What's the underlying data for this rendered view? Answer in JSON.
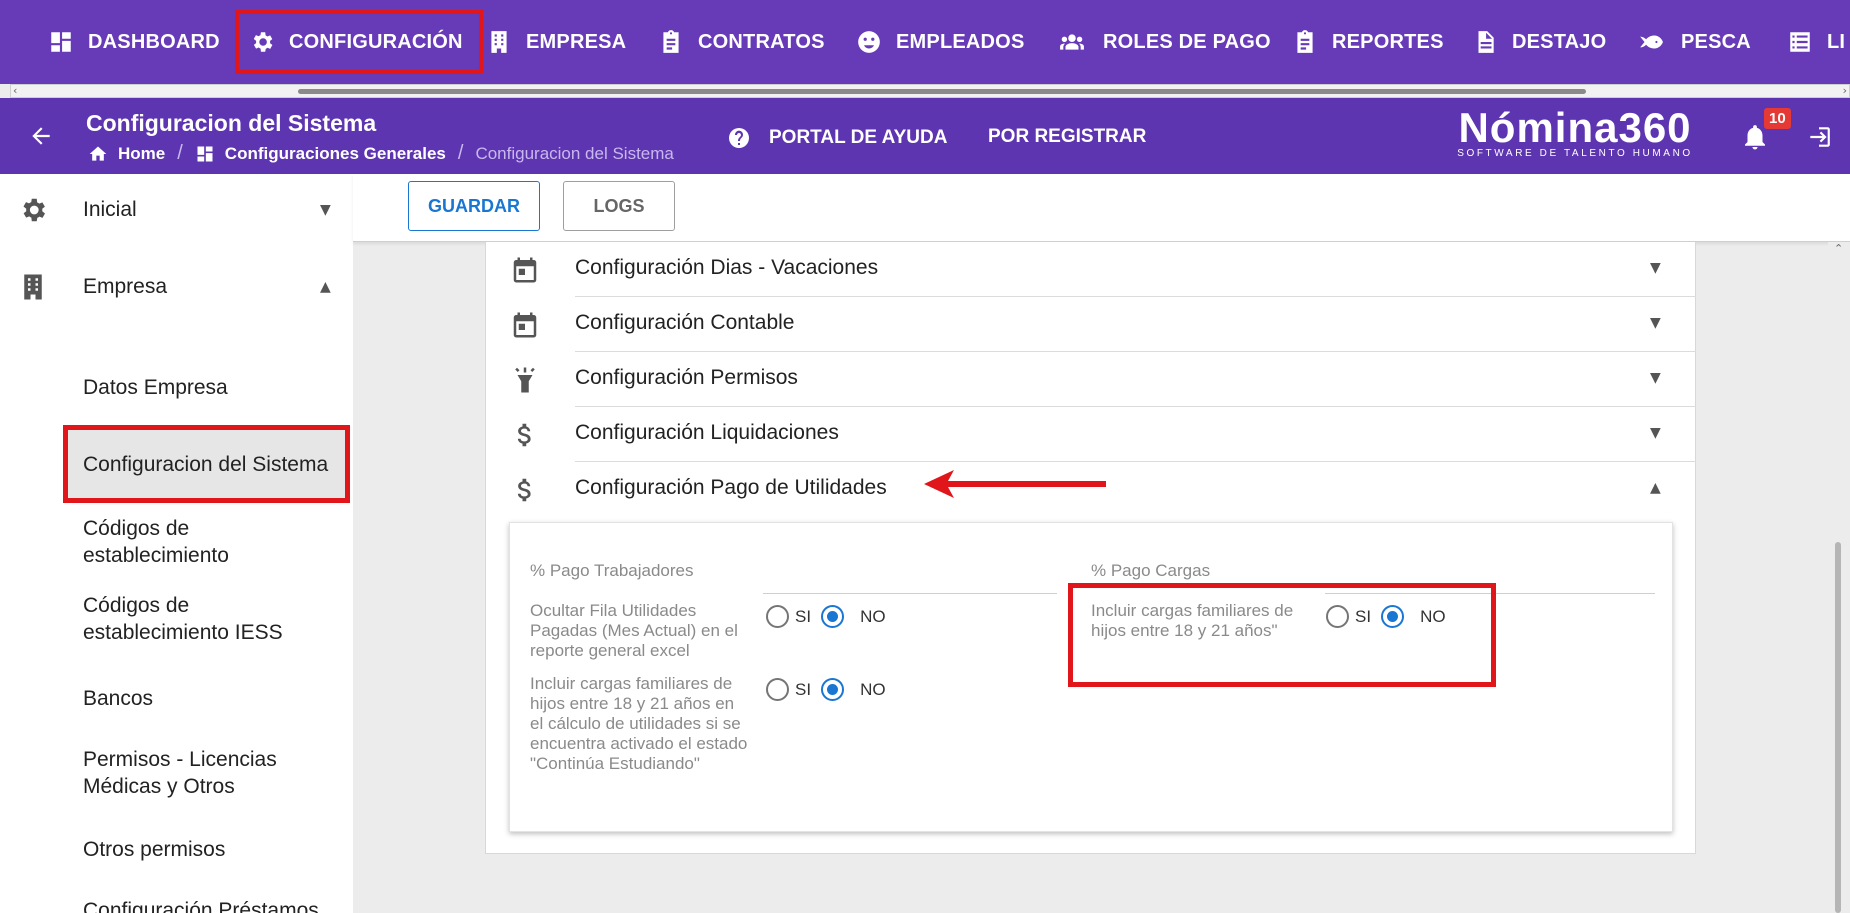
{
  "topnav": {
    "items": [
      {
        "label": "DASHBOARD",
        "icon": "dashboard-icon"
      },
      {
        "label": "CONFIGURACIÓN",
        "icon": "gear-icon",
        "active": true
      },
      {
        "label": "EMPRESA",
        "icon": "building-icon"
      },
      {
        "label": "CONTRATOS",
        "icon": "clipboard-icon"
      },
      {
        "label": "EMPLEADOS",
        "icon": "face-icon"
      },
      {
        "label": "ROLES DE PAGO",
        "icon": "group-icon"
      },
      {
        "label": "REPORTES",
        "icon": "clipboard-icon"
      },
      {
        "label": "DESTAJO",
        "icon": "document-icon"
      },
      {
        "label": "PESCA",
        "icon": "fish-icon"
      },
      {
        "label": "LI",
        "icon": "list-icon"
      }
    ]
  },
  "header": {
    "title": "Configuracion del Sistema",
    "breadcrumb": {
      "home": "Home",
      "parent": "Configuraciones Generales",
      "current": "Configuracion del Sistema"
    },
    "help_link": "PORTAL DE AYUDA",
    "register_link": "POR REGISTRAR",
    "logo_name": "Nómina360",
    "logo_tagline": "SOFTWARE DE TALENTO HUMANO",
    "notification_count": "10"
  },
  "sidebar": {
    "groups": [
      {
        "label": "Inicial",
        "icon": "gear-icon",
        "expanded": false
      },
      {
        "label": "Empresa",
        "icon": "building-icon",
        "expanded": true
      }
    ],
    "subitems": [
      "Datos Empresa",
      "Configuracion del Sistema",
      "Códigos de establecimiento",
      "Códigos de establecimiento IESS",
      "Bancos",
      "Permisos - Licencias Médicas y Otros",
      "Otros permisos",
      "Configuración Préstamos"
    ],
    "active_index": 1
  },
  "toolbar": {
    "save_label": "GUARDAR",
    "logs_label": "LOGS"
  },
  "accordion": [
    {
      "title": "Configuración Dias - Vacaciones",
      "icon": "calendar-icon",
      "expanded": false
    },
    {
      "title": "Configuración Contable",
      "icon": "calendar-icon",
      "expanded": false
    },
    {
      "title": "Configuración Permisos",
      "icon": "lamp-icon",
      "expanded": false
    },
    {
      "title": "Configuración Liquidaciones",
      "icon": "dollar-icon",
      "expanded": false
    },
    {
      "title": "Configuración Pago de Utilidades",
      "icon": "dollar-icon",
      "expanded": true
    }
  ],
  "utilidades": {
    "workers": {
      "title": "% Pago Trabajadores",
      "options": [
        {
          "label": "Ocultar Fila Utilidades Pagadas (Mes Actual) en el reporte general excel",
          "yes": "SI",
          "no": "NO",
          "selected": "NO"
        },
        {
          "label": "Incluir cargas familiares de hijos entre 18 y 21 años en el cálculo de utilidades si se encuentra activado el estado \"Continúa Estudiando\"",
          "yes": "SI",
          "no": "NO",
          "selected": "NO"
        }
      ]
    },
    "dependents": {
      "title": "% Pago Cargas",
      "options": [
        {
          "label": "Incluir cargas familiares de hijos entre 18 y 21 años\"",
          "yes": "SI",
          "no": "NO",
          "selected": "NO"
        }
      ]
    }
  },
  "colors": {
    "topnav_bg": "#673ab7",
    "header_bg": "#5e35b1",
    "accent": "#1976d2",
    "highlight": "#e0161b"
  }
}
